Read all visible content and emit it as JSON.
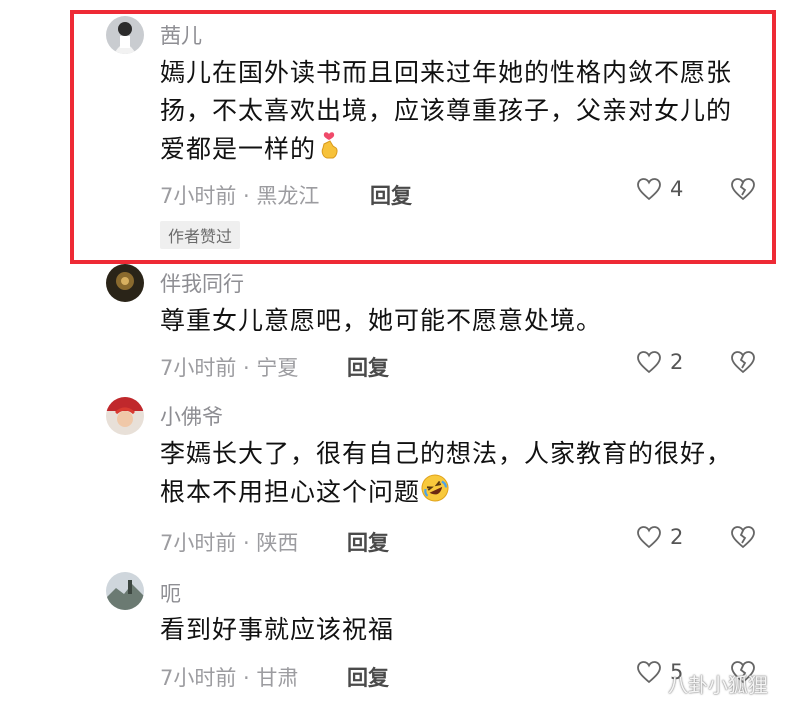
{
  "comments": [
    {
      "username": "茜儿",
      "text": "嫣儿在国外读书而且回来过年她的性格内敛不愿张扬，不太喜欢出境，应该尊重孩子，父亲对女儿的爱都是一样的",
      "emoji_icon": "finger-heart-icon",
      "meta": "7小时前 · 黑龙江",
      "reply_label": "回复",
      "likes": "4",
      "badge": "作者赞过",
      "highlighted": true
    },
    {
      "username": "伴我同行",
      "text": "尊重女儿意愿吧，她可能不愿意处境。",
      "meta": "7小时前 · 宁夏",
      "reply_label": "回复",
      "likes": "2"
    },
    {
      "username": "小佛爷",
      "text": "李嫣长大了，很有自己的想法，人家教育的很好，根本不用担心这个问题",
      "emoji_icon": "rolling-laughing-icon",
      "meta": "7小时前 · 陕西",
      "reply_label": "回复",
      "likes": "2"
    },
    {
      "username": "呃",
      "text": "看到好事就应该祝福",
      "meta": "7小时前 · 甘肃",
      "reply_label": "回复",
      "likes": "5"
    }
  ],
  "watermark": "八卦小狐狸",
  "colors": {
    "highlight_border": "#ee2a35",
    "meta_gray": "#9c9ca0"
  }
}
